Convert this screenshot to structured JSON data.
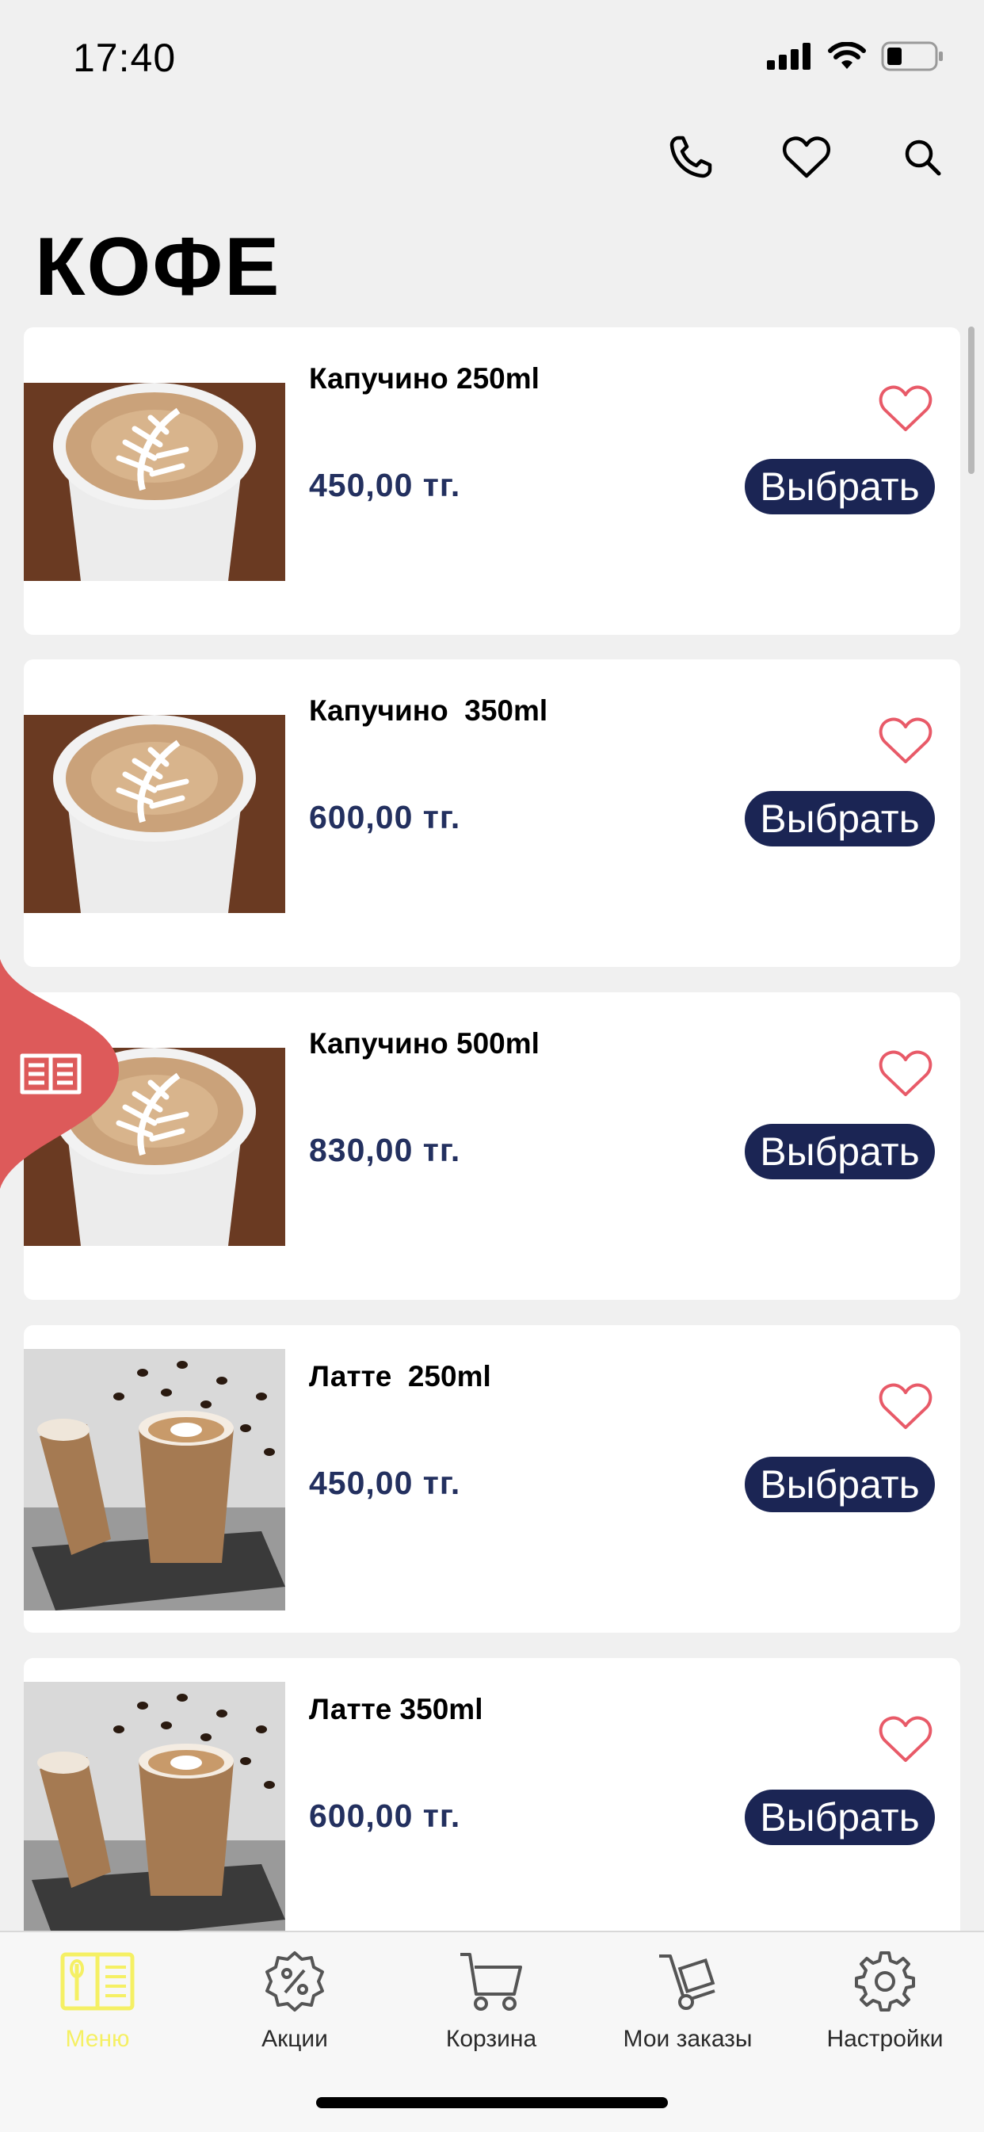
{
  "status_bar": {
    "time": "17:40"
  },
  "header": {
    "icons": [
      "phone-icon",
      "heart-icon",
      "search-icon"
    ],
    "title": "КОФЕ"
  },
  "products": [
    {
      "name": "Капучино 250ml",
      "price": "450,00 тг.",
      "button_label": "Выбрать",
      "image": "cappuccino-cup"
    },
    {
      "name": "Капучино  350ml",
      "price": "600,00 тг.",
      "button_label": "Выбрать",
      "image": "cappuccino-cup"
    },
    {
      "name": "Капучино 500ml",
      "price": "830,00 тг.",
      "button_label": "Выбрать",
      "image": "cappuccino-cup"
    },
    {
      "name": "Латте  250ml",
      "price": "450,00 тг.",
      "button_label": "Выбрать",
      "image": "latte-cups-beans"
    },
    {
      "name": "Латте 350ml",
      "price": "600,00 тг.",
      "button_label": "Выбрать",
      "image": "latte-cups-beans"
    }
  ],
  "floating_menu": {
    "icon": "book-menu-icon"
  },
  "tab_bar": {
    "items": [
      {
        "label": "Меню",
        "icon": "menu-book-icon",
        "active": true
      },
      {
        "label": "Акции",
        "icon": "discount-badge-icon",
        "active": false
      },
      {
        "label": "Корзина",
        "icon": "cart-icon",
        "active": false
      },
      {
        "label": "Мои заказы",
        "icon": "hand-truck-icon",
        "active": false
      },
      {
        "label": "Настройки",
        "icon": "gear-icon",
        "active": false
      }
    ]
  },
  "colors": {
    "background": "#f0f0f0",
    "card": "#ffffff",
    "price": "#23305f",
    "button": "#1b2554",
    "favorite": "#e85a68",
    "fab": "#dd5a5a",
    "active_tab": "#f5f064"
  }
}
